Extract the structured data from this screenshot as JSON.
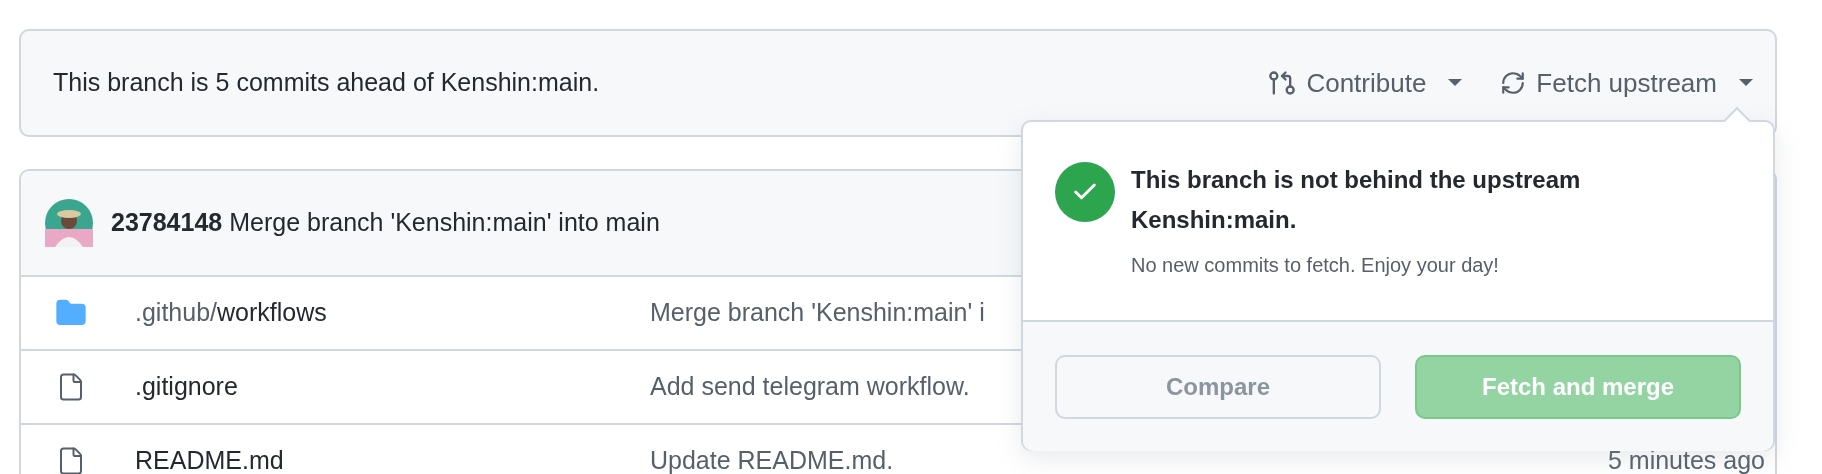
{
  "banner": {
    "text": "This branch is 5 commits ahead of Kenshin:main.",
    "actions": [
      {
        "label": "Contribute",
        "kind": "contribute"
      },
      {
        "label": "Fetch upstream",
        "kind": "fetch"
      }
    ]
  },
  "latest_commit": {
    "hash": "23784148",
    "message": "Merge branch 'Kenshin:main' into main"
  },
  "files": [
    {
      "kind": "folder",
      "path": ".github/",
      "name": "workflows",
      "message": "Merge branch 'Kenshin:main' i"
    },
    {
      "kind": "file",
      "name": ".gitignore",
      "message": "Add send telegram workflow."
    },
    {
      "kind": "file",
      "name": "README.md",
      "message": "Update README.md.",
      "time": "5 minutes ago"
    }
  ],
  "popover": {
    "title": "This branch is not behind the upstream Kenshin:main.",
    "description": "No new commits to fetch. Enjoy your day!",
    "buttons": [
      {
        "label": "Compare",
        "kind": "secondary",
        "disabled": true
      },
      {
        "label": "Fetch and merge",
        "kind": "primary",
        "disabled": true
      }
    ]
  }
}
